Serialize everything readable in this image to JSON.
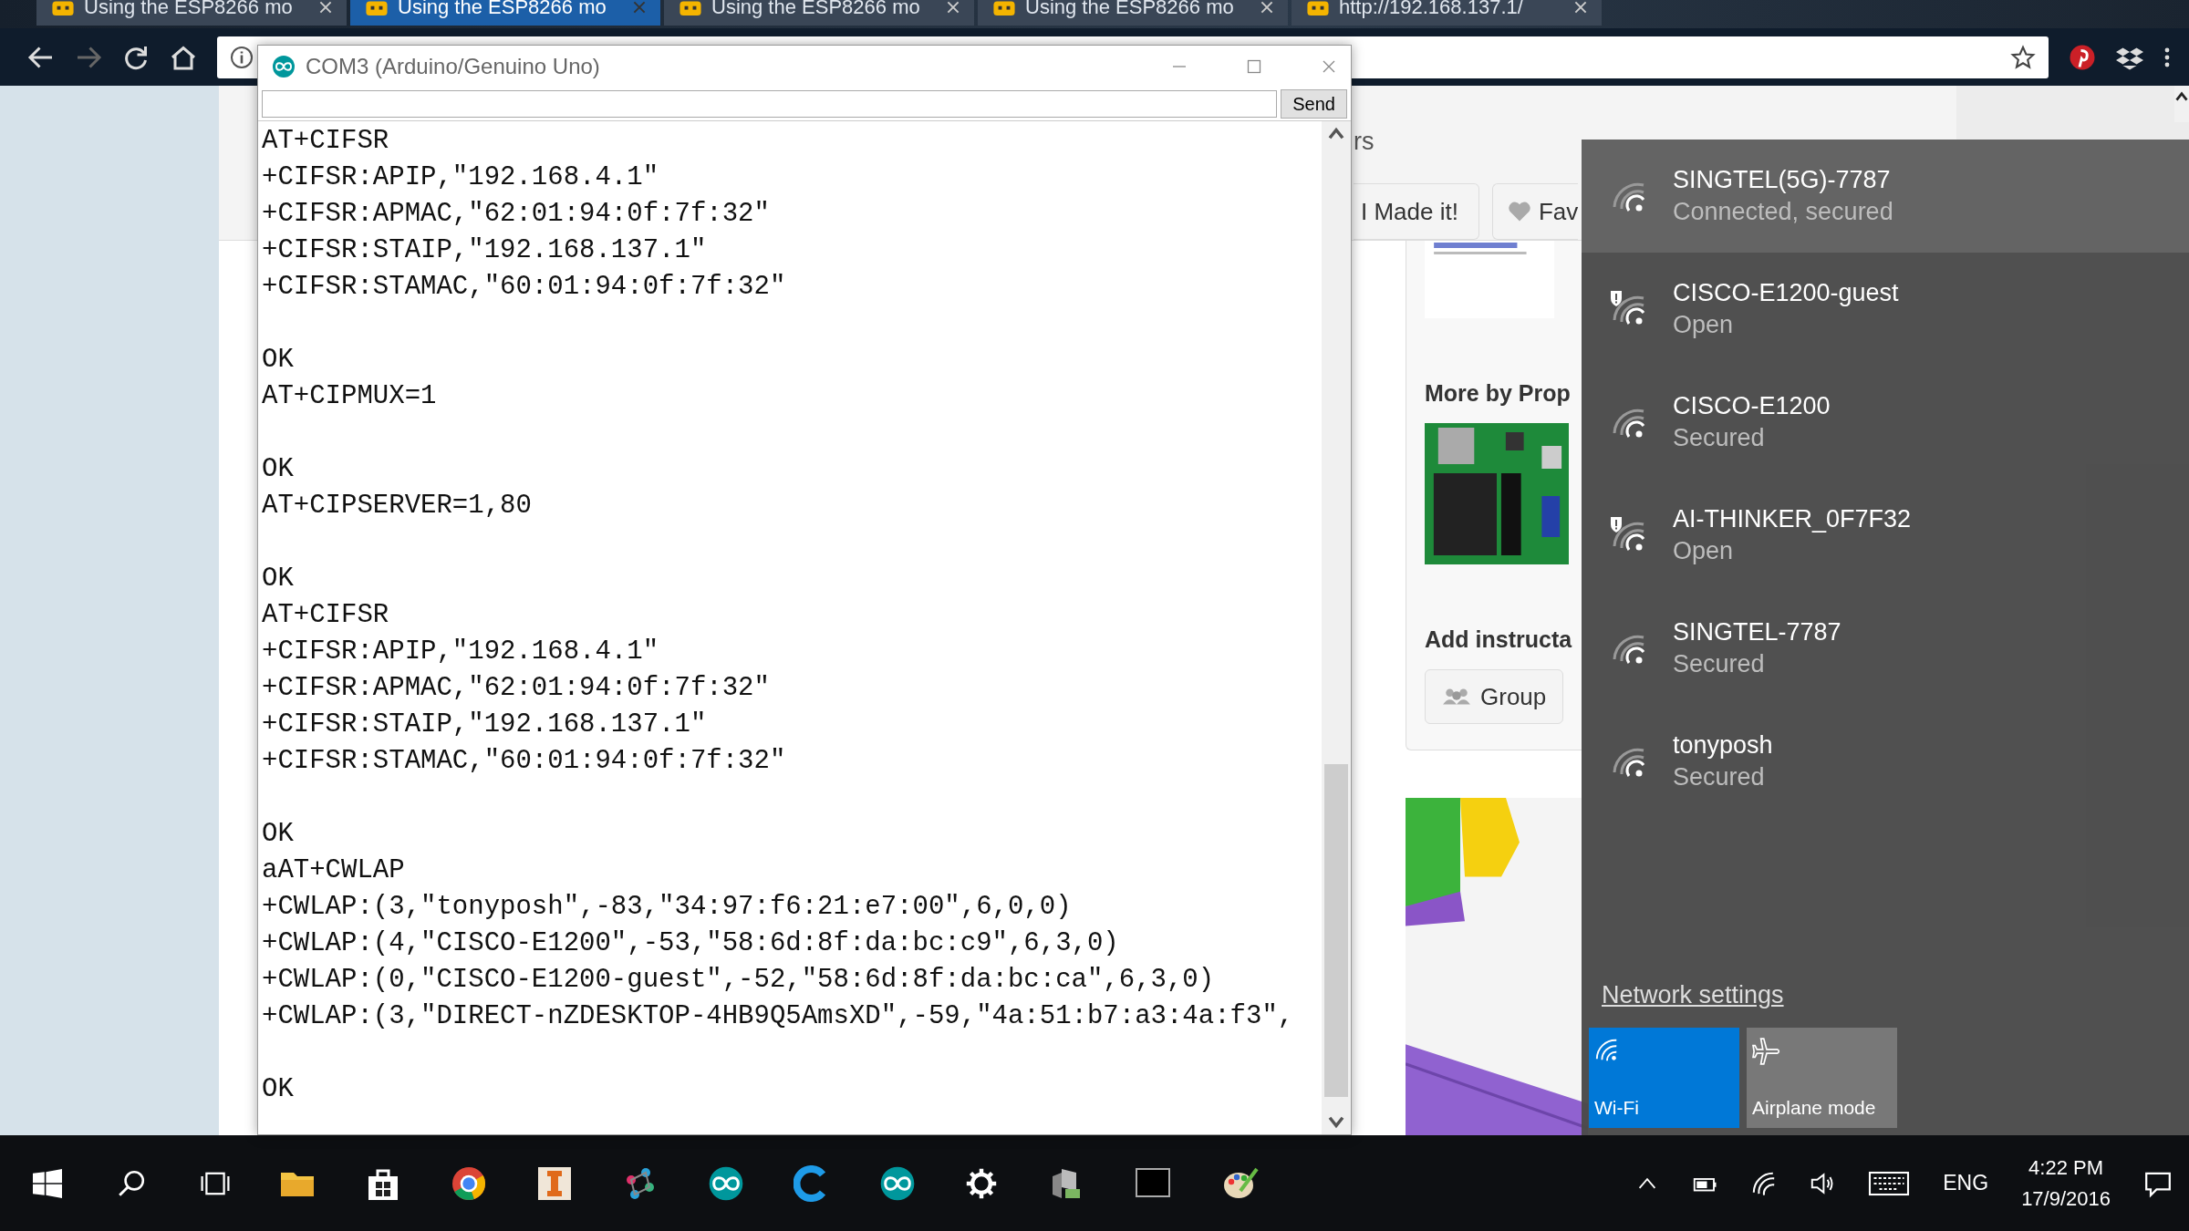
{
  "browser": {
    "tabs": [
      {
        "title": "Using the ESP8266 mo",
        "selected": false
      },
      {
        "title": "Using the ESP8266 mo",
        "selected": true
      },
      {
        "title": "Using the ESP8266 mo",
        "selected": false
      },
      {
        "title": "Using the ESP8266 mo",
        "selected": false
      },
      {
        "title": "http://192.168.137.1/",
        "selected": false
      }
    ],
    "page": {
      "header_fragment": "rs",
      "buttons": [
        "I Made it!",
        "Fav"
      ],
      "more_by": "More by Prop",
      "add_heading": "Add instructa",
      "group_button": "Group"
    }
  },
  "serial_monitor": {
    "title": "COM3 (Arduino/Genuino Uno)",
    "send_label": "Send",
    "output": [
      [
        "AT+CIFSR",
        "+CIFSR:APIP,\"192.168.4.1\"",
        "+CIFSR:APMAC,\"62:01:94:0f:7f:32\"",
        "+CIFSR:STAIP,\"192.168.137.1\"",
        "+CIFSR:STAMAC,\"60:01:94:0f:7f:32\""
      ],
      [
        "OK",
        "AT+CIPMUX=1"
      ],
      [
        "OK",
        "AT+CIPSERVER=1,80"
      ],
      [
        "OK",
        "AT+CIFSR",
        "+CIFSR:APIP,\"192.168.4.1\"",
        "+CIFSR:APMAC,\"62:01:94:0f:7f:32\"",
        "+CIFSR:STAIP,\"192.168.137.1\"",
        "+CIFSR:STAMAC,\"60:01:94:0f:7f:32\""
      ],
      [
        "OK",
        "aAT+CWLAP",
        "+CWLAP:(3,\"tonyposh\",-83,\"34:97:f6:21:e7:00\",6,0,0)",
        "+CWLAP:(4,\"CISCO-E1200\",-53,\"58:6d:8f:da:bc:c9\",6,3,0)",
        "+CWLAP:(0,\"CISCO-E1200-guest\",-52,\"58:6d:8f:da:bc:ca\",6,3,0)",
        "+CWLAP:(3,\"DIRECT-nZDESKTOP-4HB9Q5AmsXD\",-59,\"4a:51:b7:a3:4a:f3\","
      ],
      [
        "OK"
      ]
    ]
  },
  "network_flyout": {
    "networks": [
      {
        "name": "SINGTEL(5G)-7787",
        "status": "Connected, secured",
        "selected": true,
        "shield": false
      },
      {
        "name": "CISCO-E1200-guest",
        "status": "Open",
        "selected": false,
        "shield": true
      },
      {
        "name": "CISCO-E1200",
        "status": "Secured",
        "selected": false,
        "shield": false
      },
      {
        "name": "AI-THINKER_0F7F32",
        "status": "Open",
        "selected": false,
        "shield": true
      },
      {
        "name": "SINGTEL-7787",
        "status": "Secured",
        "selected": false,
        "shield": false
      },
      {
        "name": "tonyposh",
        "status": "Secured",
        "selected": false,
        "shield": false
      }
    ],
    "settings_link": "Network settings",
    "quick_actions": [
      {
        "kind": "wifi",
        "label": "Wi-Fi",
        "on": true
      },
      {
        "kind": "airplane",
        "label": "Airplane mode",
        "on": false
      }
    ]
  },
  "taskbar": {
    "language": "ENG",
    "time": "4:22 PM",
    "date": "17/9/2016"
  }
}
